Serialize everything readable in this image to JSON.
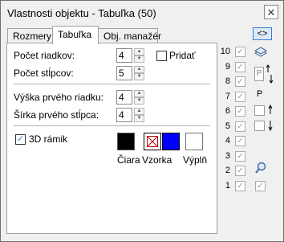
{
  "window": {
    "title": "Vlastnosti objektu - Tabuľka (50)"
  },
  "tabs": [
    {
      "label": "Rozmery",
      "active": false
    },
    {
      "label": "Tabuľka",
      "active": true
    },
    {
      "label": "Obj. manažér",
      "active": false
    }
  ],
  "form": {
    "rows_label": "Počet riadkov:",
    "rows_value": "4",
    "add_label": "Pridať",
    "cols_label": "Počet stĺpcov:",
    "cols_value": "5",
    "first_row_height_label": "Výška prvého riadku:",
    "first_row_height_value": "4",
    "first_col_width_label": "Šírka prvého stĺpca:",
    "first_col_width_value": "4",
    "frame3d_label": "3D rámik",
    "frame3d_checked": true,
    "line_label": "Čiara",
    "pattern_label": "Vzorka",
    "fill_label": "Výplň",
    "line_color": "#000000",
    "pattern_color": "#0000ff",
    "fill_color": "#ffffff"
  },
  "sidebar": {
    "swap_label": "<>",
    "row_numbers": [
      "10",
      "9",
      "8",
      "7",
      "6",
      "5",
      "4",
      "3",
      "2",
      "1"
    ],
    "p_label": "P",
    "p_label2": "P"
  }
}
